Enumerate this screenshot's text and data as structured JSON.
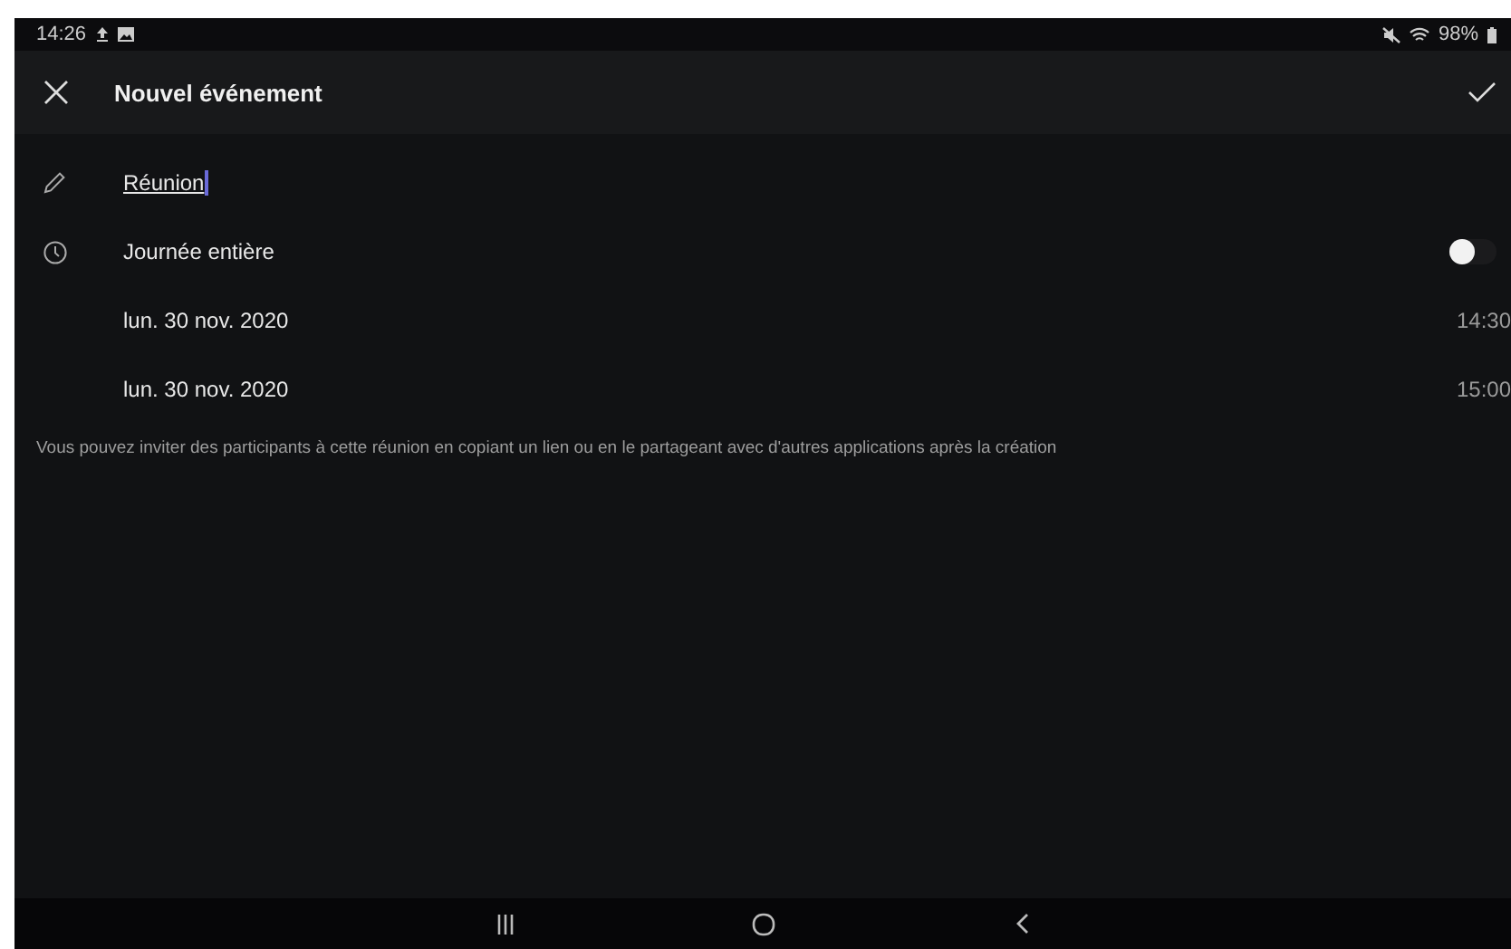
{
  "status_bar": {
    "time": "14:26",
    "battery": "98%"
  },
  "header": {
    "title": "Nouvel événement"
  },
  "title_field": {
    "value": "Réunion"
  },
  "all_day": {
    "label": "Journée entière",
    "on": false
  },
  "dates": [
    {
      "date": "lun. 30 nov. 2020",
      "time": "14:30"
    },
    {
      "date": "lun. 30 nov. 2020",
      "time": "15:00"
    }
  ],
  "note": "Vous pouvez inviter des participants à cette réunion en copiant un lien ou en le partageant avec d'autres applications après la création"
}
